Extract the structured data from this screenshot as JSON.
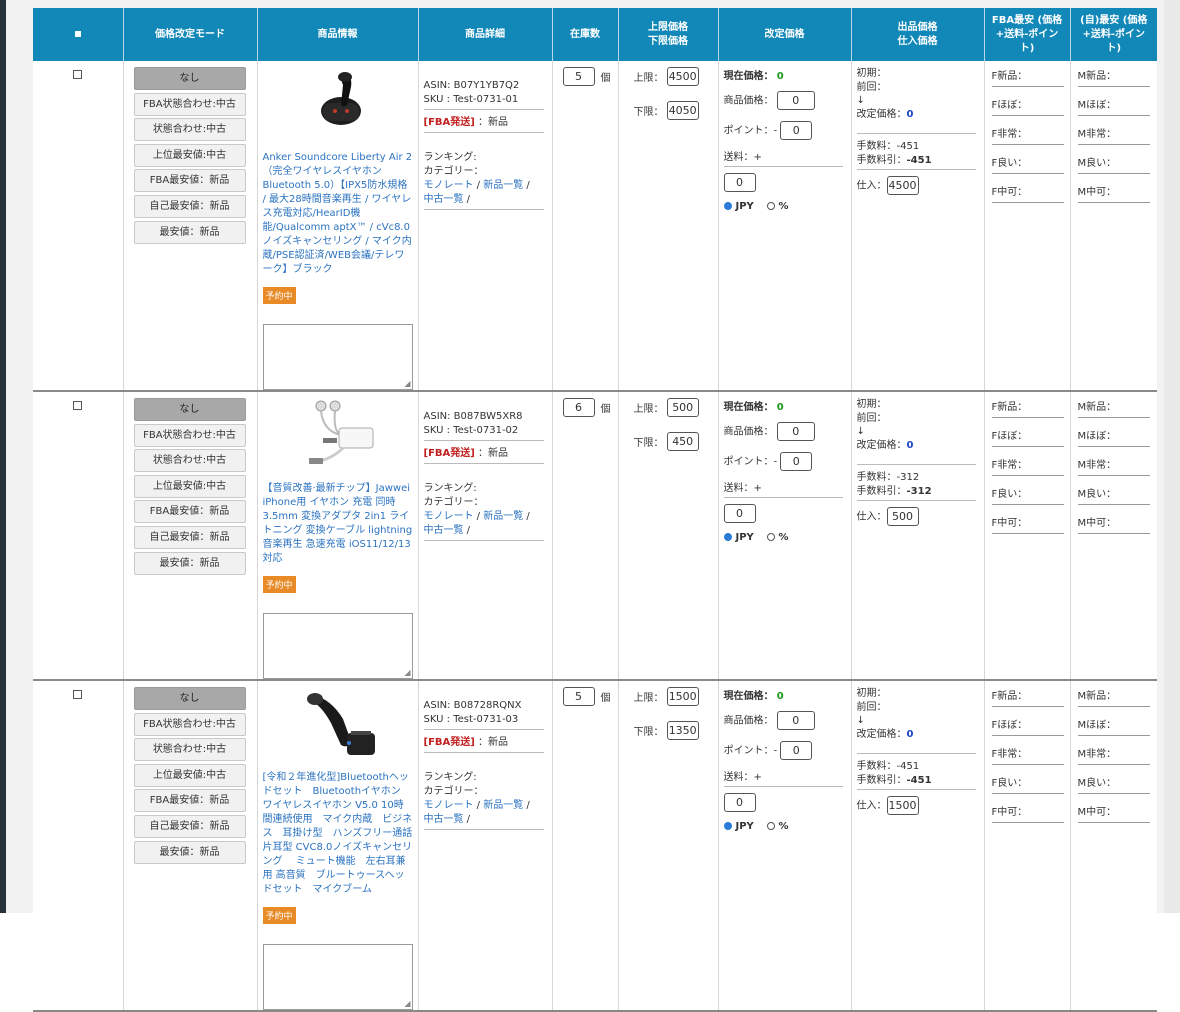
{
  "header": {
    "select_all": "■",
    "mode": "価格改定モード",
    "product_info": "商品情報",
    "product_detail": "商品詳細",
    "stock": "在庫数",
    "upper_price": "上限価格",
    "lower_price": "下限価格",
    "revised_price": "改定価格",
    "listing_price": "出品価格",
    "purchase_price": "仕入価格",
    "fba_lowest_line1": "FBA最安 (価格",
    "fba_lowest_line2": "+送料-ポイン",
    "fba_lowest_line3": "ト)",
    "self_lowest_line1": "(自)最安 (価格",
    "self_lowest_line2": "+送料-ポイン",
    "self_lowest_line3": "ト)"
  },
  "labels": {
    "asin": "ASIN: ",
    "sku": "SKU : ",
    "fba": "[FBA発送]",
    "condition_new": "：新品",
    "ranking": "ランキング:",
    "category": "カテゴリー：",
    "monorate": "モノレート",
    "new_list": "新品一覧",
    "used_list": "中古一覧",
    "sep": " / ",
    "unit": "個",
    "upper": "上限：",
    "lower": "下限：",
    "current_price": "現在価格：",
    "item_price": "商品価格：",
    "point": "ポイント：-",
    "shipping": "送料：+",
    "jpy": "JPY",
    "percent": "%",
    "initial": "初期：",
    "previous": "前回：",
    "arrow": "↓",
    "revised": "改定価格：",
    "fee": "手数料：",
    "fee_deducted": "手数料引：",
    "purchase": "仕入：",
    "reserve": "予約中",
    "fba_items": [
      "F新品：",
      "Fほぼ：",
      "F非常：",
      "F良い：",
      "F中可："
    ],
    "self_items": [
      "M新品：",
      "Mほぼ：",
      "M非常：",
      "M良い：",
      "M中可："
    ]
  },
  "modes": [
    "なし",
    "FBA状態合わせ:中古",
    "状態合わせ:中古",
    "上位最安値:中古",
    "FBA最安値：新品",
    "自己最安値：新品",
    "最安値：新品"
  ],
  "rows": [
    {
      "title": "Anker Soundcore Liberty Air 2（完全ワイヤレスイヤホン Bluetooth 5.0）【IPX5防水規格 / 最大28時間音楽再生 / ワイヤレス充電対応/HearID機能/Qualcomm aptX™ / cVc8.0ノイズキャンセリング / マイク内蔵/PSE認証済/WEB会議/テレワーク】ブラック",
      "asin": "B07Y1YB7Q2",
      "sku": "Test-0731-01",
      "stock": "5",
      "upper": "4500",
      "lower": "4050",
      "current": "0",
      "item_price": "0",
      "point": "0",
      "shipping": "0",
      "revised": "0",
      "fee": "-451",
      "fee_deducted": "-451",
      "purchase": "4500"
    },
    {
      "title": "【音質改善·最新チップ】Jawwei iPhone用 イヤホン 充電 同時 3.5mm 変換アダプタ 2in1 ライトニング 変換ケーブル lightning 音楽再生 急速充電 iOS11/12/13対応",
      "asin": "B087BW5XR8",
      "sku": "Test-0731-02",
      "stock": "6",
      "upper": "500",
      "lower": "450",
      "current": "0",
      "item_price": "0",
      "point": "0",
      "shipping": "0",
      "revised": "0",
      "fee": "-312",
      "fee_deducted": "-312",
      "purchase": "500"
    },
    {
      "title": "[令和２年進化型]Bluetoothヘッドセット　Bluetoothイヤホン　ワイヤレスイヤホン V5.0 10時間連続使用　マイク内蔵　ビジネス　耳掛け型　ハンズフリー通話　片耳型 CVC8.0ノイズキャンセリング　 ミュート機能　左右耳兼用 高音質　ブルートゥースヘッドセット　マイクブーム",
      "asin": "B08728RQNX",
      "sku": "Test-0731-03",
      "stock": "5",
      "upper": "1500",
      "lower": "1350",
      "current": "0",
      "item_price": "0",
      "point": "0",
      "shipping": "0",
      "revised": "0",
      "fee": "-451",
      "fee_deducted": "-451",
      "purchase": "1500"
    }
  ],
  "icons": {
    "image1": "earbuds-icon",
    "image2": "adapter-cable-icon",
    "image3": "bluetooth-headset-icon"
  },
  "colors": {
    "header_bg": "#1188b8",
    "link": "#2b73c1",
    "badge": "#e88a26",
    "fba": "#c21f1f",
    "price_ok": "#1a9a1a",
    "revised": "#1a44c8"
  }
}
